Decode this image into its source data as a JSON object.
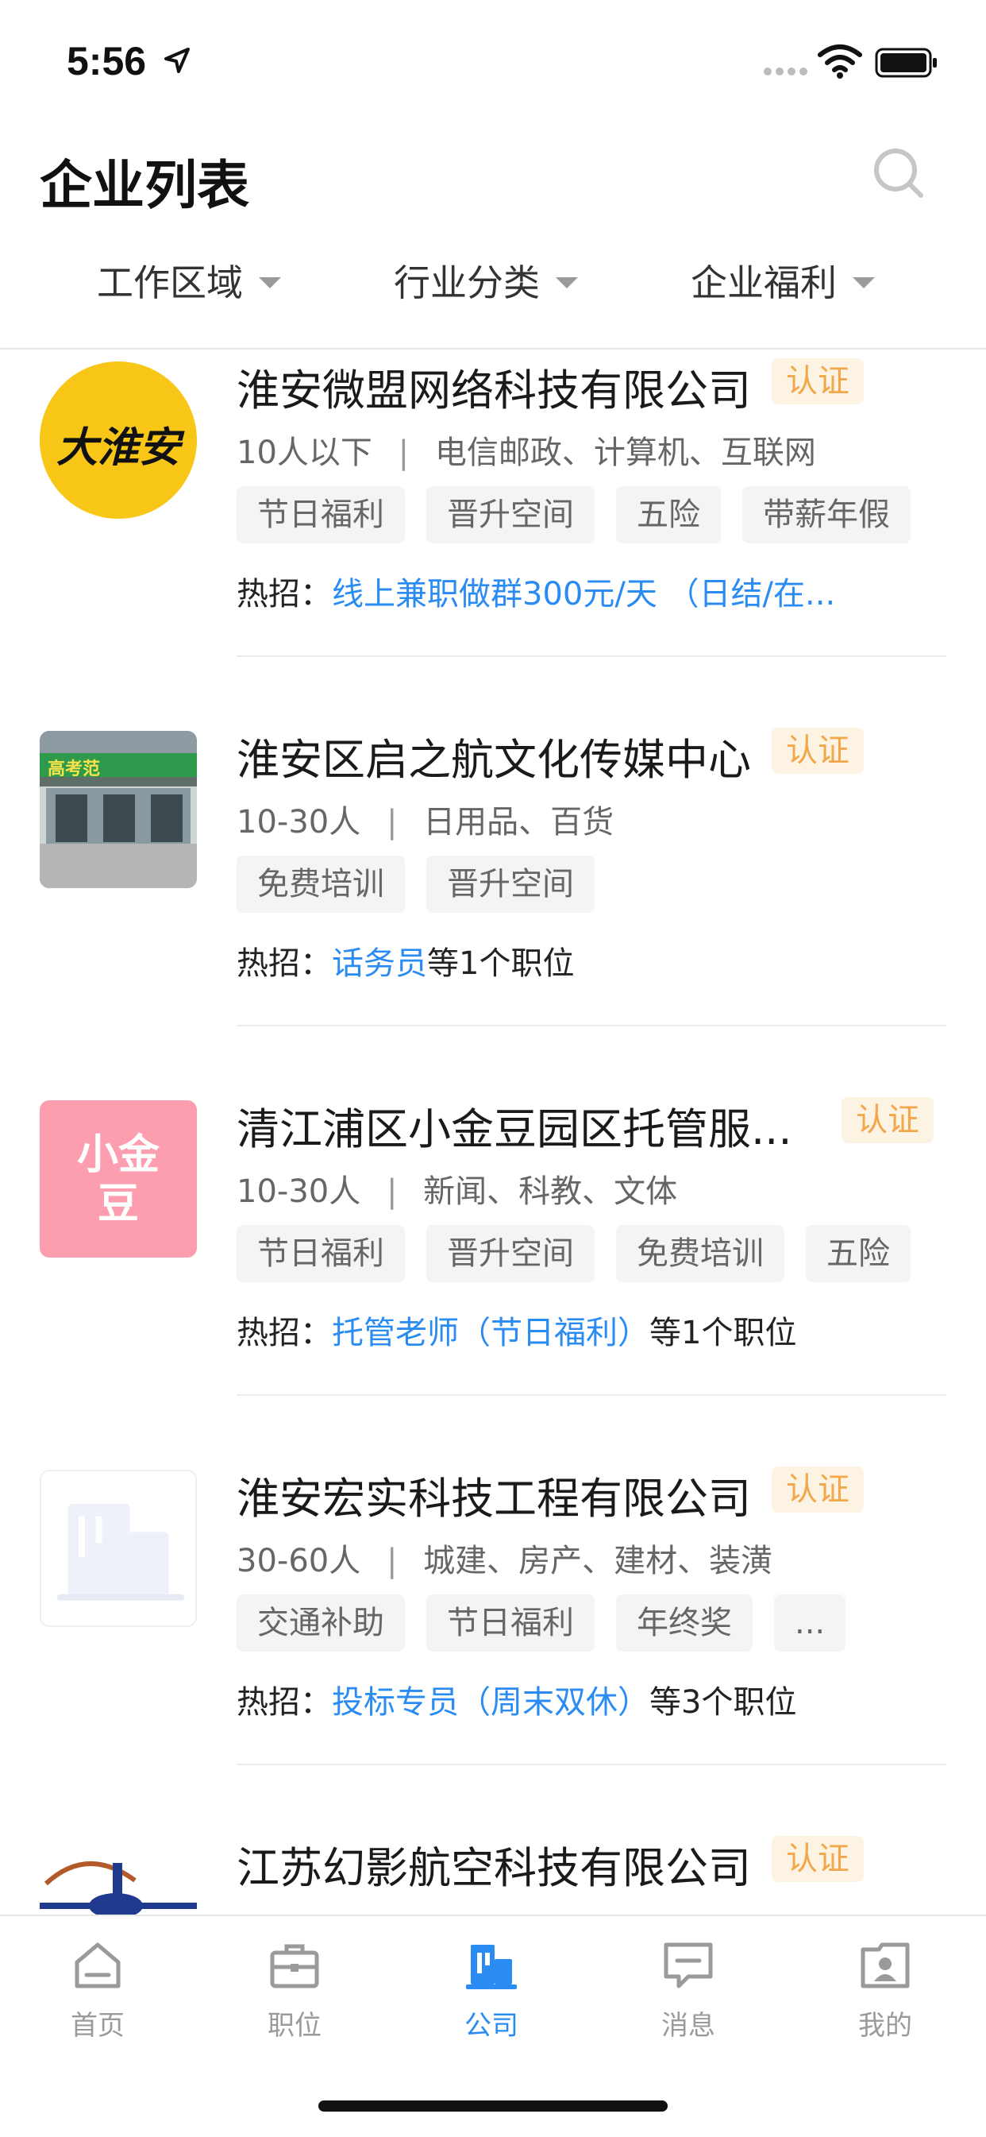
{
  "status_bar": {
    "time": "5:56"
  },
  "header": {
    "title": "企业列表"
  },
  "filters": [
    {
      "label": "工作区域"
    },
    {
      "label": "行业分类"
    },
    {
      "label": "企业福利"
    }
  ],
  "companies": [
    {
      "logo_text": "大淮安",
      "name": "淮安微盟网络科技有限公司",
      "cert": "认证",
      "size": "10人以下",
      "industry": "电信邮政、计算机、互联网",
      "tags": [
        "节日福利",
        "晋升空间",
        "五险",
        "带薪年假"
      ],
      "hot_label": "热招：",
      "hot_job": "线上兼职做群300元/天 （日结/在...",
      "hot_suffix": ""
    },
    {
      "logo_text": "高考范",
      "name": "淮安区启之航文化传媒中心",
      "cert": "认证",
      "size": "10-30人",
      "industry": "日用品、百货",
      "tags": [
        "免费培训",
        "晋升空间"
      ],
      "hot_label": "热招：",
      "hot_job": "话务员",
      "hot_suffix": "等1个职位"
    },
    {
      "logo_text": "小金豆",
      "name": "清江浦区小金豆园区托管服...",
      "cert": "认证",
      "size": "10-30人",
      "industry": "新闻、科教、文体",
      "tags": [
        "节日福利",
        "晋升空间",
        "免费培训",
        "五险"
      ],
      "hot_label": "热招：",
      "hot_job": "托管老师（节日福利）",
      "hot_suffix": "等1个职位"
    },
    {
      "logo_text": "",
      "name": "淮安宏实科技工程有限公司",
      "cert": "认证",
      "size": "30-60人",
      "industry": "城建、房产、建材、装潢",
      "tags": [
        "交通补助",
        "节日福利",
        "年终奖",
        "..."
      ],
      "hot_label": "热招：",
      "hot_job": "投标专员（周末双休）",
      "hot_suffix": "等3个职位"
    },
    {
      "logo_text": "",
      "name": "江苏幻影航空科技有限公司",
      "cert": "认证",
      "size": "",
      "industry": "",
      "tags": [],
      "hot_label": "",
      "hot_job": "",
      "hot_suffix": ""
    }
  ],
  "tabbar": {
    "items": [
      {
        "label": "首页",
        "icon": "home-icon"
      },
      {
        "label": "职位",
        "icon": "briefcase-icon"
      },
      {
        "label": "公司",
        "icon": "building-icon"
      },
      {
        "label": "消息",
        "icon": "message-icon"
      },
      {
        "label": "我的",
        "icon": "profile-icon"
      }
    ],
    "active_index": 2
  },
  "colors": {
    "accent": "#2a8cf2",
    "cert_text": "#f2a74a",
    "cert_bg": "#fdf3e3"
  }
}
